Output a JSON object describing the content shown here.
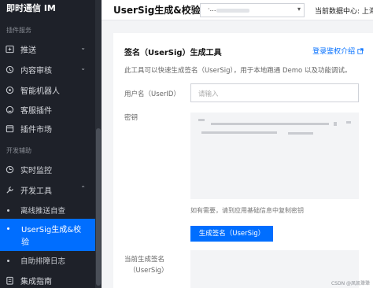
{
  "sidebar": {
    "app_title": "即时通信 IM",
    "section_plugins": "插件服务",
    "section_devtools": "开发辅助",
    "items": [
      {
        "label": "推送",
        "icon": "push-icon",
        "chevron": "⌄"
      },
      {
        "label": "内容审核",
        "icon": "audit-icon",
        "chevron": "⌄"
      },
      {
        "label": "智能机器人",
        "icon": "robot-icon"
      },
      {
        "label": "客服插件",
        "icon": "support-icon"
      },
      {
        "label": "插件市场",
        "icon": "market-icon"
      },
      {
        "label": "实时监控",
        "icon": "monitor-icon"
      },
      {
        "label": "开发工具",
        "icon": "tool-icon",
        "chevron": "⌃"
      }
    ],
    "sub_items": [
      {
        "label": "离线推送自查"
      },
      {
        "label": "UserSig生成&校验",
        "line1": "UserSig生成&校",
        "line2": "验"
      },
      {
        "label": "自助排障日志"
      }
    ],
    "bottom_item": {
      "label": "集成指南",
      "icon": "guide-icon"
    }
  },
  "header": {
    "title": "UserSig生成&校验",
    "app_select_value": "·…",
    "data_center_label": "当前数据中心: 上海"
  },
  "card": {
    "title": "签名（UserSig）生成工具",
    "link": "登录鉴权介绍",
    "link_icon": "external-link-icon",
    "description": "此工具可以快速生成签名（UserSig），用于本地跑通 Demo 以及功能调试。",
    "username_label": "用户名（UserID）",
    "username_placeholder": "请输入",
    "key_label": "密钥",
    "key_hint": "如有需要，请到应用基础信息中复制密钥",
    "generate_button": "生成签名（UserSig）",
    "current_label_1": "当前生成签名",
    "current_label_2": "（UserSig）"
  },
  "watermark": "CSDN @凤凯犟犟",
  "colors": {
    "accent": "#006eff",
    "sidebar_bg": "#1e2129"
  }
}
